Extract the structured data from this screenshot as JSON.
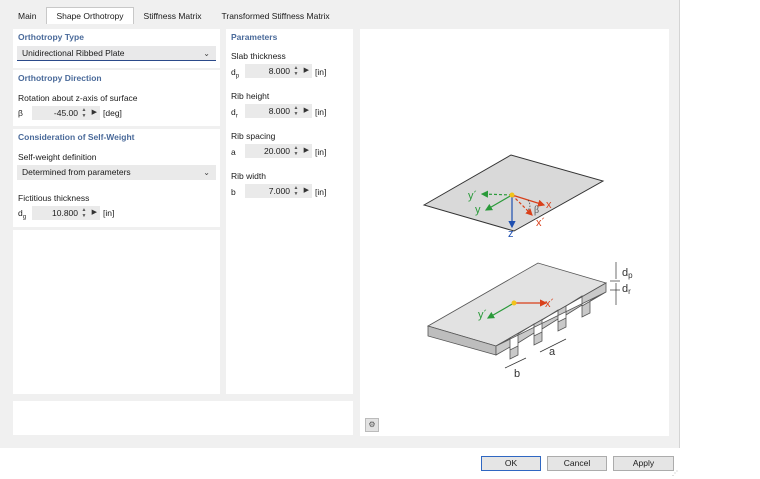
{
  "tabs": [
    {
      "label": "Main"
    },
    {
      "label": "Shape Orthotropy"
    },
    {
      "label": "Stiffness Matrix"
    },
    {
      "label": "Transformed Stiffness Matrix"
    }
  ],
  "orthotropy_type": {
    "title": "Orthotropy Type",
    "selected": "Unidirectional Ribbed Plate"
  },
  "orthotropy_direction": {
    "title": "Orthotropy Direction",
    "rotation_label": "Rotation about z-axis of surface",
    "symbol": "β",
    "value": "-45.00",
    "unit": "[deg]"
  },
  "self_weight": {
    "title": "Consideration of Self-Weight",
    "definition_label": "Self-weight definition",
    "definition_selected": "Determined from parameters",
    "fictitious_label": "Fictitious thickness",
    "fictitious_symbol": "dg",
    "fictitious_value": "10.800",
    "fictitious_unit": "[in]"
  },
  "parameters": {
    "title": "Parameters",
    "items": [
      {
        "label": "Slab thickness",
        "symbol": "dp",
        "value": "8.000",
        "unit": "[in]"
      },
      {
        "label": "Rib height",
        "symbol": "dr",
        "value": "8.000",
        "unit": "[in]"
      },
      {
        "label": "Rib spacing",
        "symbol": "a",
        "value": "20.000",
        "unit": "[in]"
      },
      {
        "label": "Rib width",
        "symbol": "b",
        "value": "7.000",
        "unit": "[in]"
      }
    ]
  },
  "figure": {
    "plate_labels": {
      "y_prime": "y´",
      "y": "y",
      "x": "x",
      "x_prime": "x´",
      "z": "z",
      "beta": "β"
    },
    "rib_labels": {
      "dp": "dp",
      "dr": "dr",
      "y_prime": "y´",
      "x_prime": "x´",
      "a": "a",
      "b": "b"
    }
  },
  "buttons": {
    "ok": "OK",
    "cancel": "Cancel",
    "apply": "Apply"
  },
  "colors": {
    "accent": "#2f67c2",
    "section_title": "#4a6a9a",
    "axis_x": "#d9401a",
    "axis_y": "#2a9a3a",
    "axis_z": "#1e4fb0",
    "origin": "#f2c31a"
  }
}
